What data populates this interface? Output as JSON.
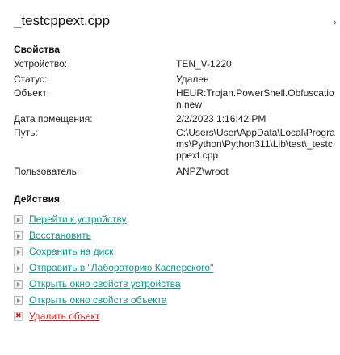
{
  "header": {
    "title": "_testcppext.cpp",
    "close_glyph": "›"
  },
  "properties": {
    "section_title": "Свойства",
    "rows": [
      {
        "label": "Устройство:",
        "value": "TEN_V-1220"
      },
      {
        "label": "Статус:",
        "value": "Удален"
      },
      {
        "label": "Объект:",
        "value": "HEUR:Trojan.PowerShell.Obfuscation.new"
      },
      {
        "label": "Дата помещения:",
        "value": "2/2/2023 1:16:42 PM"
      },
      {
        "label": "Путь:",
        "value": "C:\\Users\\User\\AppData\\Local\\Programs\\Python\\Python311\\Lib\\test\\_testcppext.cpp"
      },
      {
        "label": "Пользователь:",
        "value": "ANPZ\\wroot"
      }
    ]
  },
  "actions": {
    "section_title": "Действия",
    "items": [
      {
        "label": "Перейти к устройству",
        "icon": "play-arrow-icon"
      },
      {
        "label": "Восстановить",
        "icon": "play-arrow-icon"
      },
      {
        "label": "Сохранить на диск",
        "icon": "play-arrow-icon"
      },
      {
        "label": "Отправить в \"Лабораторию Касперского\"",
        "icon": "play-arrow-icon"
      },
      {
        "label": "Открыть окно свойств устройства",
        "icon": "play-arrow-icon"
      },
      {
        "label": "Открыть окно свойств объекта",
        "icon": "play-arrow-icon"
      },
      {
        "label": "Удалить объект",
        "icon": "delete-x-icon"
      }
    ]
  },
  "colors": {
    "link": "#11998e",
    "danger_link": "#d01f1f"
  }
}
